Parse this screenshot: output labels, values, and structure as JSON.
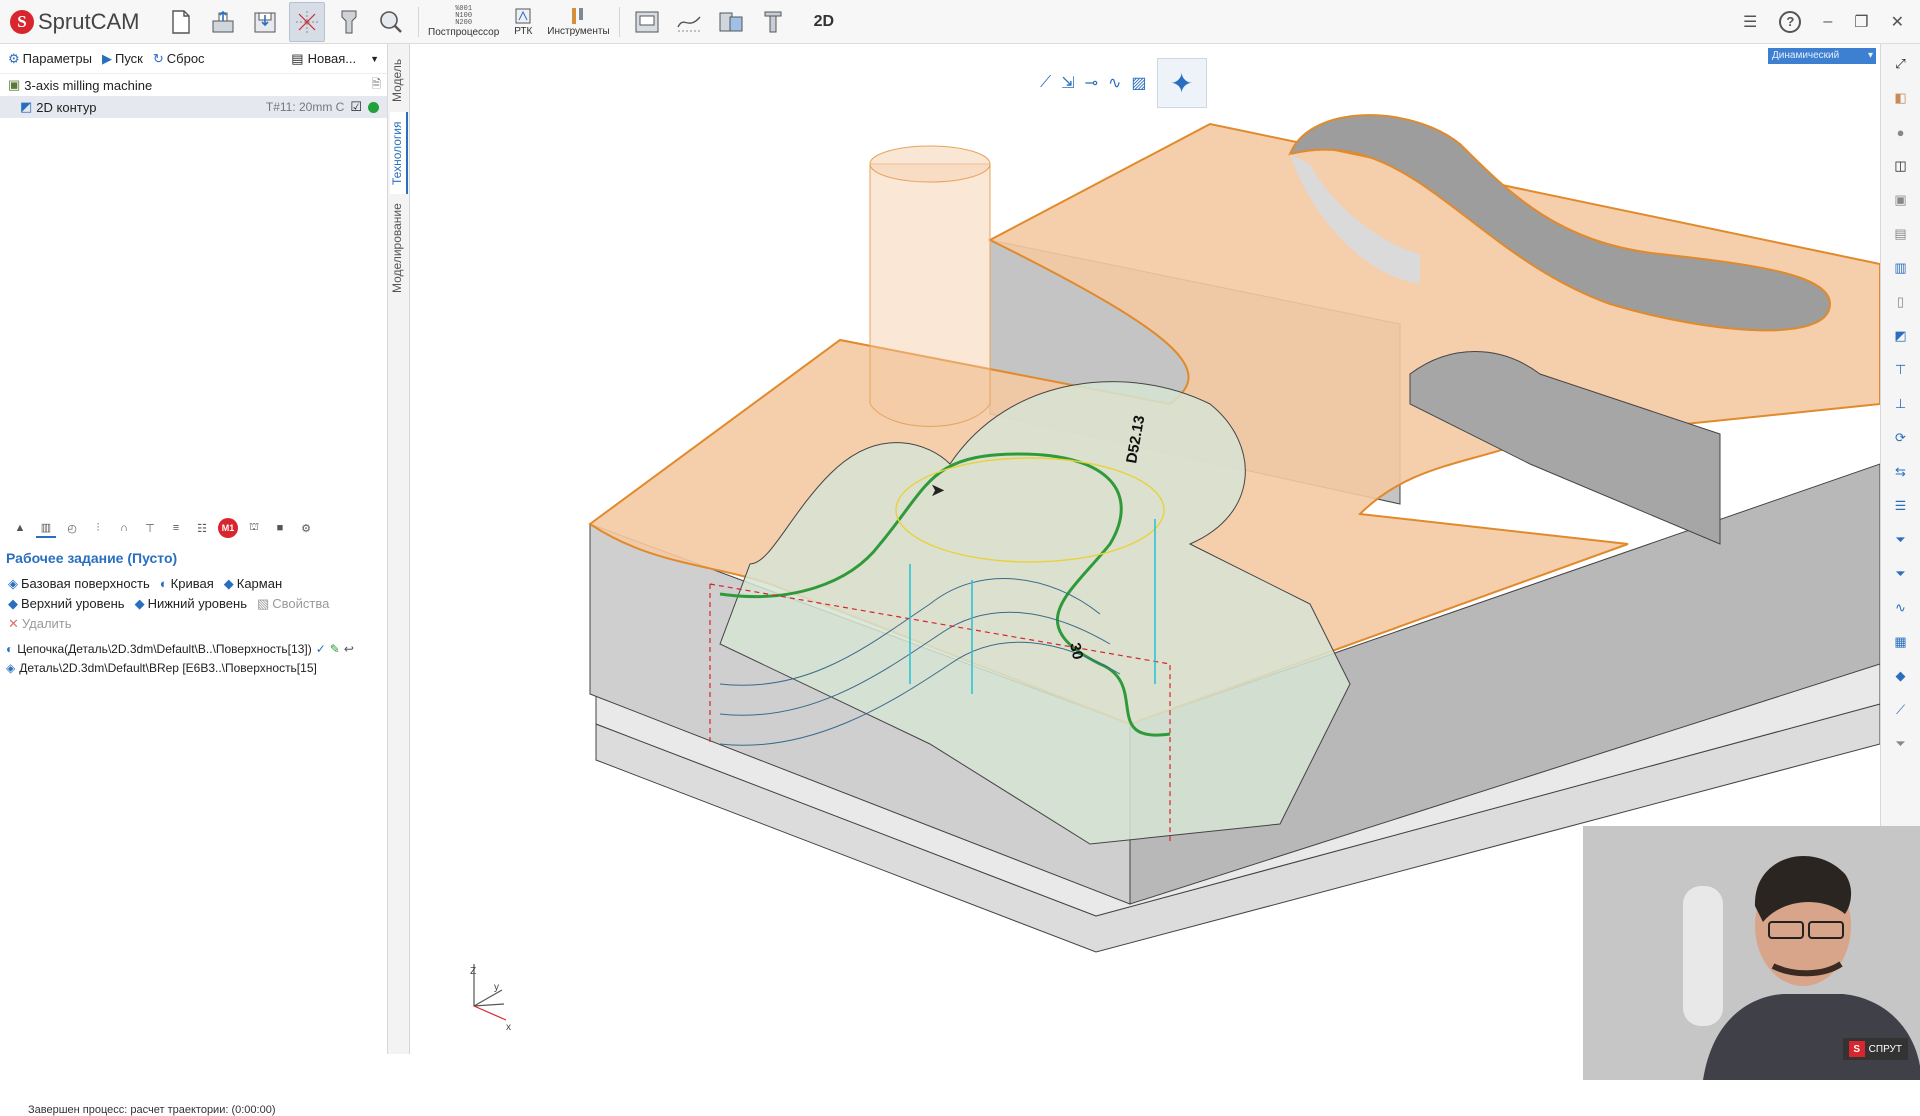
{
  "app": {
    "name": "SprutCAM"
  },
  "toolbar": {
    "postprocessor_label": "Постпроцессор",
    "postprocessor_glyph": "%001\nN100\nN200",
    "rtk_label": "РТК",
    "tools_label": "Инструменты",
    "mode_2d": "2D"
  },
  "view_selector": {
    "value": "Динамический"
  },
  "operations": {
    "params_label": "Параметры",
    "run_label": "Пуск",
    "reset_label": "Сброс",
    "new_label": "Новая...",
    "machine": "3-axis milling machine",
    "selected_op": {
      "name": "2D контур",
      "tool": "T#11: 20mm C"
    }
  },
  "side_tabs": {
    "model": "Модель",
    "technology": "Технология",
    "modeling": "Моделирование"
  },
  "task": {
    "title": "Рабочее задание  (Пусто)",
    "base_surface": "Базовая поверхность",
    "curve": "Кривая",
    "pocket": "Карман",
    "top_level": "Верхний уровень",
    "bottom_level": "Нижний уровень",
    "properties": "Свойства",
    "delete": "Удалить",
    "chain_item": "Цепочка(Деталь\\2D.3dm\\Default\\B..\\Поверхность[13])",
    "part_item": "Деталь\\2D.3dm\\Default\\BRep [E6B3..\\Поверхность[15]"
  },
  "viewport": {
    "dim_diameter": "D52.13",
    "dim_depth": "30",
    "axis_z": "Z",
    "axis_y": "y",
    "axis_x": "x"
  },
  "status": {
    "text": "Завершен процесс: расчет траектории: (0:00:00)"
  },
  "webcam": {
    "badge": "СПРУТ",
    "badge_letter": "S"
  },
  "colors": {
    "accent": "#2a6fbf",
    "part_top": "#f4c9a3",
    "part_edge": "#e08a2c",
    "toolpath": "#2f9a3a",
    "brand": "#d7262d"
  }
}
